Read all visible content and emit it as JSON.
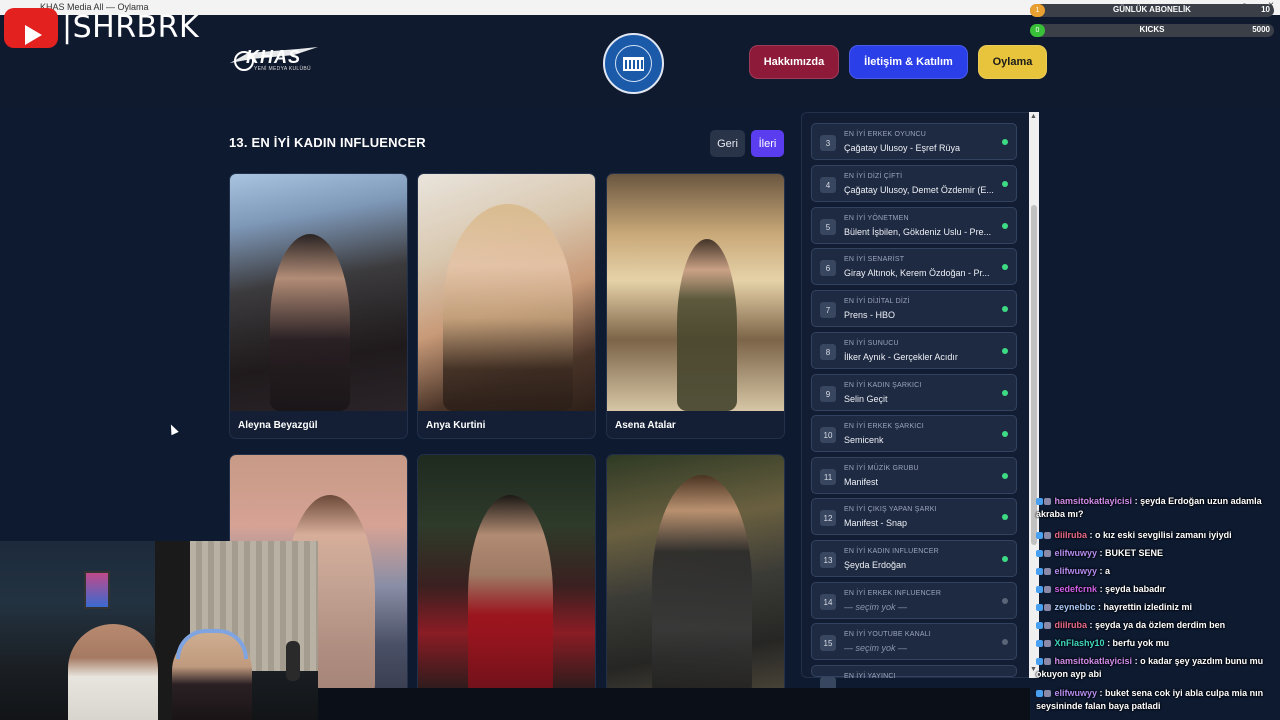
{
  "window": {
    "title": "KHAS Media All — Oylama"
  },
  "header": {
    "logo_text": "KHAS",
    "logo_sub": "YENİ MEDYA KULÜBÜ",
    "seal_alt": "Kadir Has Üniversitesi",
    "nav": [
      {
        "label": "Hakkımızda"
      },
      {
        "label": "İletişim & Katılım"
      },
      {
        "label": "Oylama"
      }
    ]
  },
  "section": {
    "title": "13. EN İYİ KADIN INFLUENCER",
    "back_label": "Geri",
    "next_label": "İleri"
  },
  "candidates": [
    {
      "name": "Aleyna Beyazgül"
    },
    {
      "name": "Anya Kurtini"
    },
    {
      "name": "Asena Atalar"
    },
    {
      "name": ""
    },
    {
      "name": ""
    },
    {
      "name": ""
    }
  ],
  "votes": [
    {
      "num": "3",
      "category": "EN İYİ ERKEK OYUNCU",
      "selection": "Çağatay Ulusoy - Eşref Rüya",
      "done": true
    },
    {
      "num": "4",
      "category": "EN İYİ DİZİ ÇİFTİ",
      "selection": "Çağatay Ulusoy, Demet Özdemir (E...",
      "done": true
    },
    {
      "num": "5",
      "category": "EN İYİ YÖNETMEN",
      "selection": "Bülent İşbilen, Gökdeniz Uslu - Pre...",
      "done": true
    },
    {
      "num": "6",
      "category": "EN İYİ SENARİST",
      "selection": "Giray Altınok, Kerem Özdoğan - Pr...",
      "done": true
    },
    {
      "num": "7",
      "category": "EN İYİ DİJİTAL DİZİ",
      "selection": "Prens - HBO",
      "done": true
    },
    {
      "num": "8",
      "category": "EN İYİ SUNUCU",
      "selection": "İlker Aynık - Gerçekler Acıdır",
      "done": true
    },
    {
      "num": "9",
      "category": "EN İYİ KADIN ŞARKICI",
      "selection": "Selin Geçit",
      "done": true
    },
    {
      "num": "10",
      "category": "EN İYİ ERKEK ŞARKICI",
      "selection": "Semicenk",
      "done": true
    },
    {
      "num": "11",
      "category": "EN İYİ MÜZİK GRUBU",
      "selection": "Manifest",
      "done": true
    },
    {
      "num": "12",
      "category": "EN İYİ ÇIKIŞ YAPAN ŞARKI",
      "selection": "Manifest - Snap",
      "done": true
    },
    {
      "num": "13",
      "category": "EN İYİ KADIN INFLUENCER",
      "selection": "Şeyda Erdoğan",
      "done": true
    },
    {
      "num": "14",
      "category": "EN İYİ ERKEK INFLUENCER",
      "selection": "— seçim yok —",
      "done": false
    },
    {
      "num": "15",
      "category": "EN İYİ YOUTUBE KANALI",
      "selection": "— seçim yok —",
      "done": false
    },
    {
      "num": "",
      "category": "EN İYİ YAYINCI",
      "selection": "",
      "done": false
    }
  ],
  "stream_overlay": {
    "channel": "SHRBRK",
    "goals": [
      {
        "label": "GÜNLÜK ABONELİK",
        "value": "10",
        "icon": "1",
        "progress": 0.04,
        "color": "#e8a030"
      },
      {
        "label": "KICKS",
        "value": "5000",
        "icon": "0",
        "progress": 0.0,
        "color": "#38c038"
      }
    ]
  },
  "chat": [
    {
      "user": "hamsitokatlayicisi",
      "color": "#d08ce8",
      "text": ": şeyda Erdoğan uzun adamla akraba mı?"
    },
    {
      "user": "diilruba",
      "color": "#e86a8a",
      "text": ": o kız eski sevgilisi zamanı iyiydi"
    },
    {
      "user": "elifwuwyy",
      "color": "#b48cf0",
      "text": ": BUKET SENE"
    },
    {
      "user": "elifwuwyy",
      "color": "#b48cf0",
      "text": ": a"
    },
    {
      "user": "sedefcrnk",
      "color": "#d060e8",
      "text": ": şeyda babadır"
    },
    {
      "user": "zeynebbc",
      "color": "#a8c8f8",
      "text": ": hayrettin izlediniz mi"
    },
    {
      "user": "diilruba",
      "color": "#e86a8a",
      "text": ": şeyda ya da özlem derdim ben"
    },
    {
      "user": "XnFlashy10",
      "color": "#40d8c0",
      "text": ": berfu yok mu"
    },
    {
      "user": "hamsitokatlayicisi",
      "color": "#d08ce8",
      "text": ": o kadar şey yazdım bunu mu okuyon ayp abi"
    },
    {
      "user": "elifwuwyy",
      "color": "#b48cf0",
      "text": ": buket sena cok iyi abla culpa mia nın seysininde falan baya patladi"
    }
  ]
}
